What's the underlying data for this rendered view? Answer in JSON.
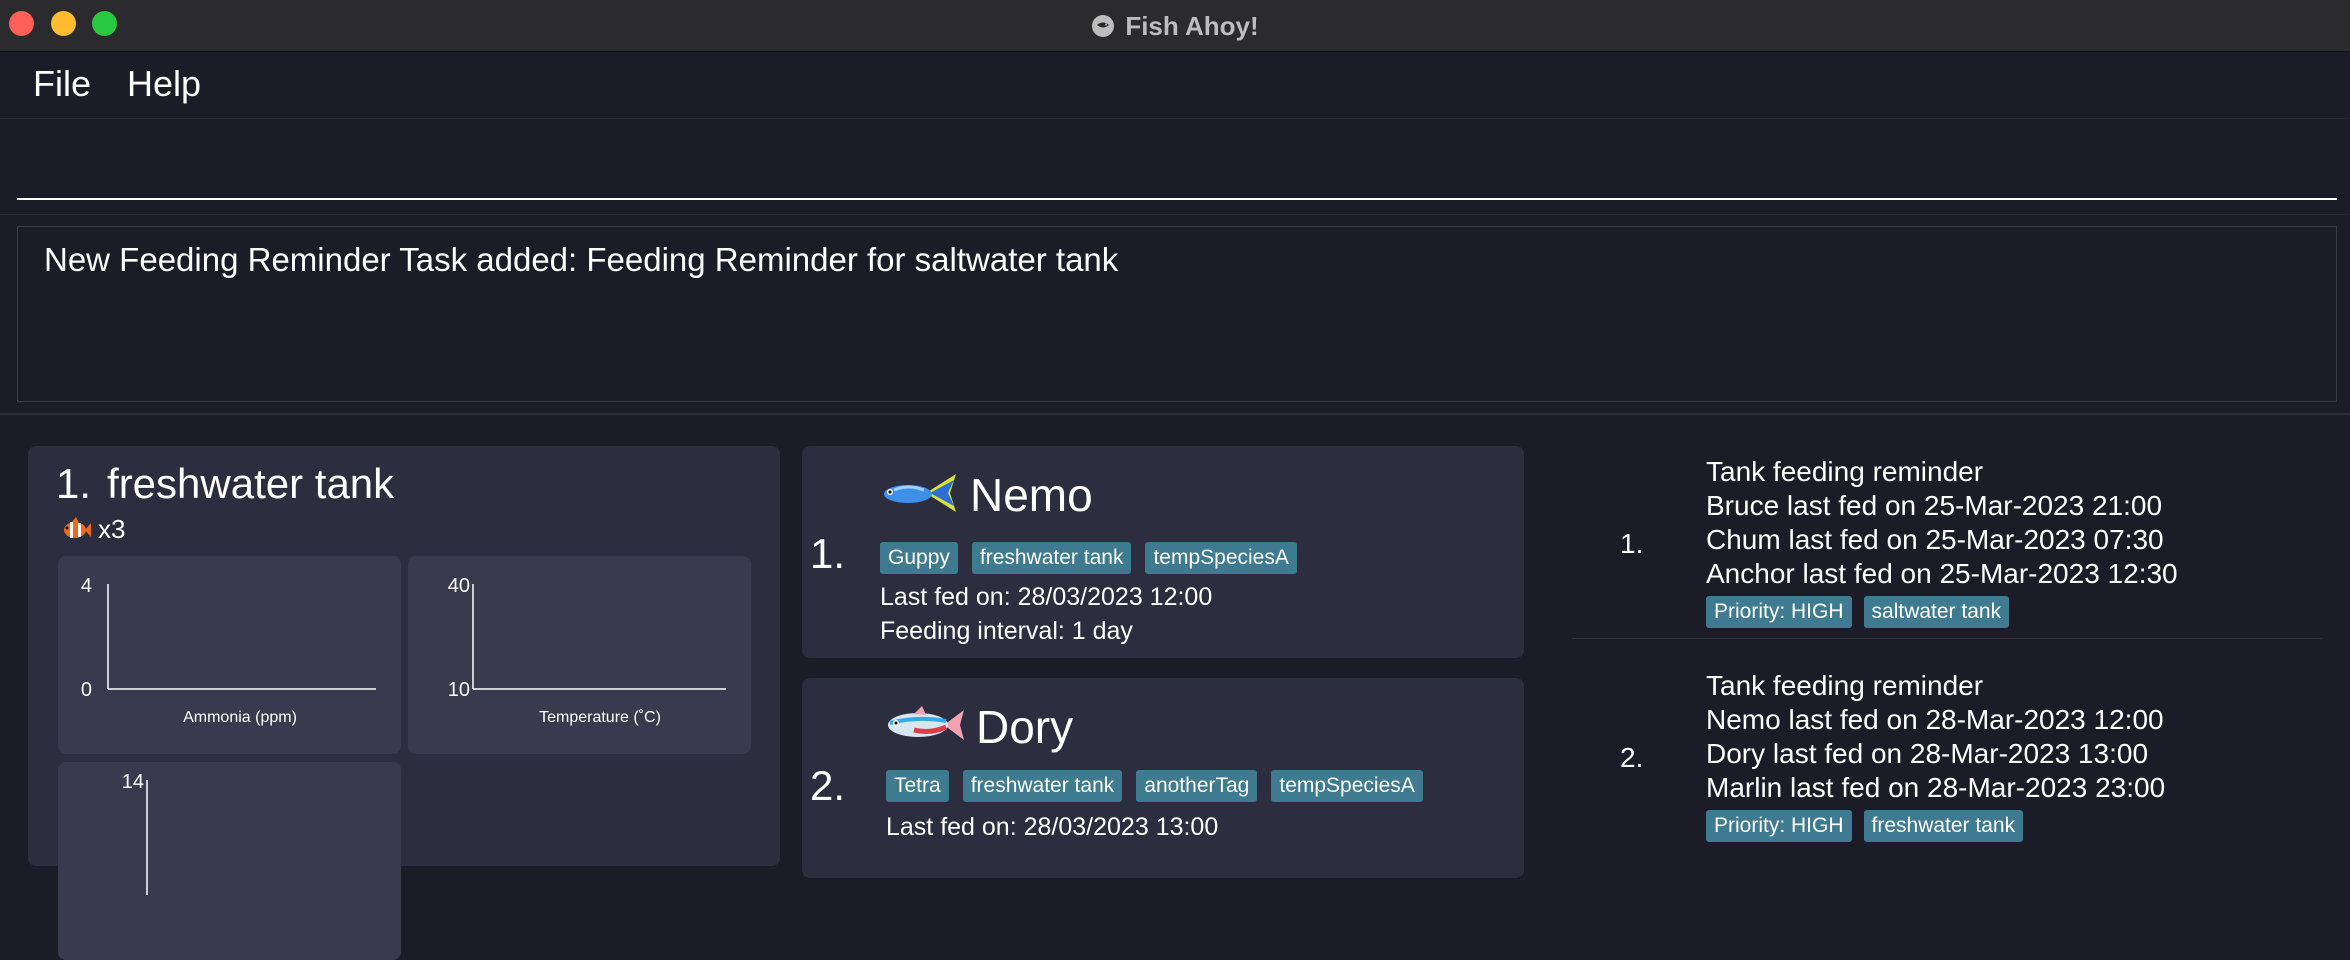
{
  "window": {
    "title": "Fish Ahoy!",
    "title_icon": "fish-ahoy-logo-icon"
  },
  "menu": {
    "file": "File",
    "help": "Help"
  },
  "command": {
    "value": "",
    "placeholder": ""
  },
  "result": {
    "message": "New Feeding Reminder Task added: Feeding Reminder for saltwater tank"
  },
  "tank": {
    "index": "1.",
    "name": "freshwater tank",
    "fish_count": "x3",
    "fish_count_icon": "clownfish-icon",
    "charts": [
      {
        "title": "",
        "xlabel": "Ammonia (ppm)",
        "ymin": "0",
        "ymax": "4"
      },
      {
        "title": "",
        "xlabel": "Temperature (˚C)",
        "ymin": "10",
        "ymax": "40"
      },
      {
        "title": "",
        "xlabel": "",
        "ymin": "",
        "ymax": "14"
      }
    ]
  },
  "fishes": [
    {
      "index": "1.",
      "name": "Nemo",
      "icon": "guppy-icon",
      "tags": [
        "Guppy",
        "freshwater tank",
        "tempSpeciesA"
      ],
      "last_fed": "Last fed on: 28/03/2023 12:00",
      "interval": "Feeding interval: 1 day"
    },
    {
      "index": "2.",
      "name": "Dory",
      "icon": "tetra-icon",
      "tags": [
        "Tetra",
        "freshwater tank",
        "anotherTag",
        "tempSpeciesA"
      ],
      "last_fed": "Last fed on: 28/03/2023 13:00",
      "interval": ""
    }
  ],
  "tasks": [
    {
      "index": "1.",
      "lines": [
        "Tank feeding reminder",
        "Bruce last fed on 25-Mar-2023 21:00",
        "Chum last fed on 25-Mar-2023 07:30",
        "Anchor last fed on 25-Mar-2023 12:30"
      ],
      "tags": [
        "Priority: HIGH",
        "saltwater tank"
      ]
    },
    {
      "index": "2.",
      "lines": [
        "Tank feeding reminder",
        "Nemo last fed on 28-Mar-2023 12:00",
        "Dory last fed on 28-Mar-2023 13:00",
        "Marlin last fed on 28-Mar-2023 23:00"
      ],
      "tags": [
        "Priority: HIGH",
        "freshwater tank"
      ]
    }
  ],
  "colors": {
    "background": "#1b1c27",
    "card": "#2c2d3e",
    "chart_card": "#393a4d",
    "tag": "#3e7b91"
  }
}
